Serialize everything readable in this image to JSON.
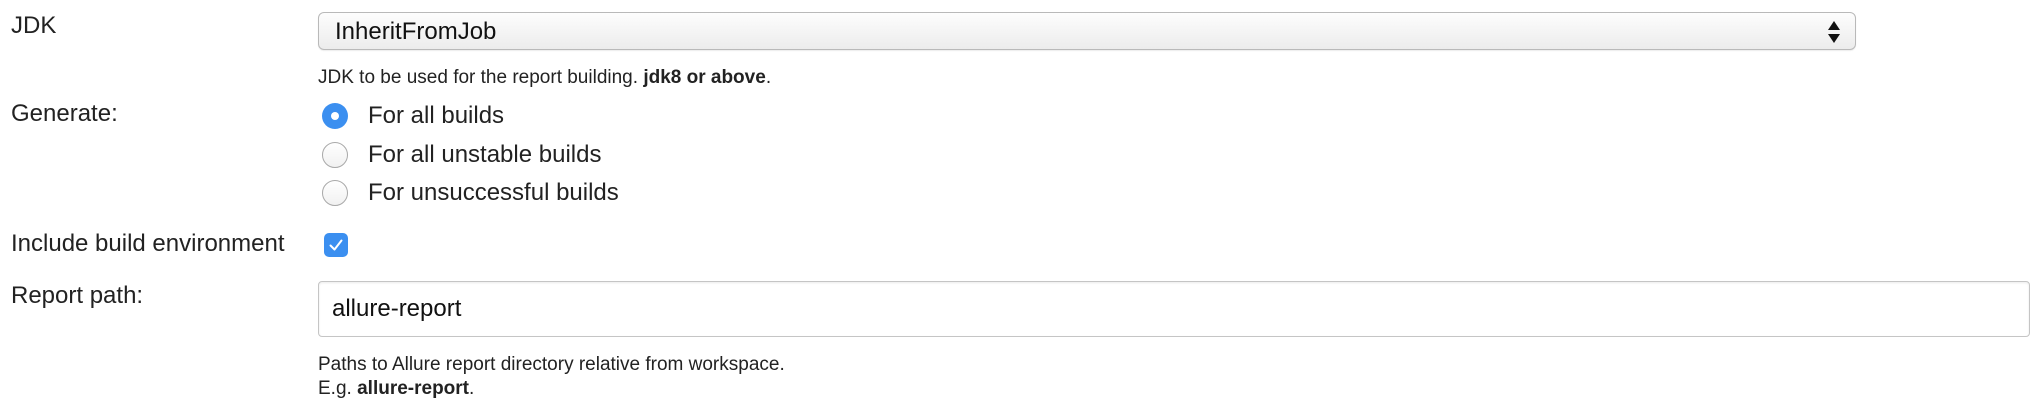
{
  "jdk": {
    "label": "JDK",
    "selected_value": "InheritFromJob",
    "help_prefix": "JDK to be used for the report building.",
    "help_bold": "jdk8 or above",
    "help_suffix": "."
  },
  "generate": {
    "label": "Generate:",
    "options": [
      {
        "label": "For all builds",
        "checked": true
      },
      {
        "label": "For all unstable builds",
        "checked": false
      },
      {
        "label": "For unsuccessful builds",
        "checked": false
      }
    ]
  },
  "include_env": {
    "label": "Include build environment",
    "checked": true
  },
  "report_path": {
    "label": "Report path:",
    "value": "allure-report",
    "help_line1": "Paths to Allure report directory relative from workspace.",
    "help_line2_prefix": "E.g.",
    "help_line2_bold": "allure-report",
    "help_line2_suffix": "."
  },
  "colors": {
    "accent": "#3b8ff0",
    "text": "#222222"
  }
}
